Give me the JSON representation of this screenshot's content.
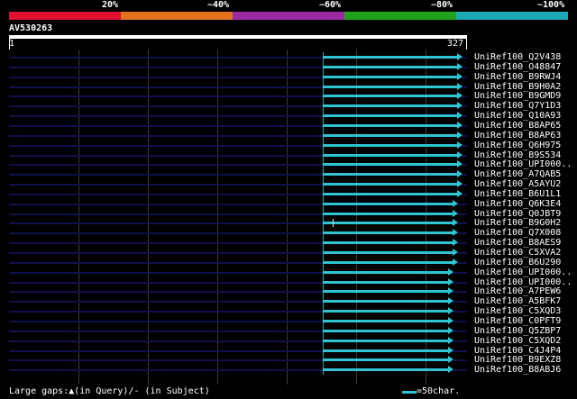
{
  "scale": {
    "labels": [
      "20%",
      "~40%",
      "~60%",
      "~80%",
      "~100%"
    ],
    "colors": [
      "#e01030",
      "#e0731c",
      "#9a2aa0",
      "#1fa21c",
      "#1aa8b4"
    ]
  },
  "query": {
    "title": "AV530263",
    "start": "1",
    "end": "327"
  },
  "hit_colors": {
    "bar": "#2fc4d2",
    "background_line": "#10104a",
    "gap_marker": "#d7dfe6"
  },
  "hits": [
    {
      "label": "UniRef100_Q2V438",
      "start_frac": 0.686,
      "end_frac": 0.99,
      "gap": null
    },
    {
      "label": "UniRef100_O48847",
      "start_frac": 0.686,
      "end_frac": 0.99,
      "gap": null
    },
    {
      "label": "UniRef100_B9RWJ4",
      "start_frac": 0.686,
      "end_frac": 0.99,
      "gap": null
    },
    {
      "label": "UniRef100_B9H0A2",
      "start_frac": 0.686,
      "end_frac": 0.99,
      "gap": null
    },
    {
      "label": "UniRef100_B9GMD9",
      "start_frac": 0.686,
      "end_frac": 0.99,
      "gap": null
    },
    {
      "label": "UniRef100_Q7Y1D3",
      "start_frac": 0.686,
      "end_frac": 0.99,
      "gap": null
    },
    {
      "label": "UniRef100_Q10A93",
      "start_frac": 0.686,
      "end_frac": 0.99,
      "gap": null
    },
    {
      "label": "UniRef100_B8AP65",
      "start_frac": 0.686,
      "end_frac": 0.99,
      "gap": null
    },
    {
      "label": "UniRef100_B8AP63",
      "start_frac": 0.686,
      "end_frac": 0.99,
      "gap": null
    },
    {
      "label": "UniRef100_Q6H975",
      "start_frac": 0.686,
      "end_frac": 0.99,
      "gap": null
    },
    {
      "label": "UniRef100_B9S534",
      "start_frac": 0.686,
      "end_frac": 0.99,
      "gap": null
    },
    {
      "label": "UniRef100_UPI000..",
      "start_frac": 0.686,
      "end_frac": 0.99,
      "gap": null
    },
    {
      "label": "UniRef100_A7QAB5",
      "start_frac": 0.686,
      "end_frac": 0.99,
      "gap": null
    },
    {
      "label": "UniRef100_A5AYU2",
      "start_frac": 0.686,
      "end_frac": 0.99,
      "gap": null
    },
    {
      "label": "UniRef100_B6U1L1",
      "start_frac": 0.686,
      "end_frac": 0.99,
      "gap": null
    },
    {
      "label": "UniRef100_Q6K3E4",
      "start_frac": 0.686,
      "end_frac": 0.98,
      "gap": null
    },
    {
      "label": "UniRef100_Q0JBT9",
      "start_frac": 0.686,
      "end_frac": 0.98,
      "gap": null
    },
    {
      "label": "UniRef100_B9G0H2",
      "start_frac": 0.686,
      "end_frac": 0.98,
      "gap": 0.707
    },
    {
      "label": "UniRef100_Q7X008",
      "start_frac": 0.686,
      "end_frac": 0.98,
      "gap": null
    },
    {
      "label": "UniRef100_B8AES9",
      "start_frac": 0.686,
      "end_frac": 0.98,
      "gap": null
    },
    {
      "label": "UniRef100_C5XVA2",
      "start_frac": 0.686,
      "end_frac": 0.98,
      "gap": null
    },
    {
      "label": "UniRef100_B6U290",
      "start_frac": 0.686,
      "end_frac": 0.98,
      "gap": null
    },
    {
      "label": "UniRef100_UPI000..",
      "start_frac": 0.686,
      "end_frac": 0.97,
      "gap": null
    },
    {
      "label": "UniRef100_UPI000..",
      "start_frac": 0.686,
      "end_frac": 0.97,
      "gap": null
    },
    {
      "label": "UniRef100_A7PEW6",
      "start_frac": 0.686,
      "end_frac": 0.97,
      "gap": null
    },
    {
      "label": "UniRef100_A5BFK7",
      "start_frac": 0.686,
      "end_frac": 0.97,
      "gap": null
    },
    {
      "label": "UniRef100_C5XQD3",
      "start_frac": 0.686,
      "end_frac": 0.97,
      "gap": null
    },
    {
      "label": "UniRef100_C0PFT9",
      "start_frac": 0.686,
      "end_frac": 0.97,
      "gap": null
    },
    {
      "label": "UniRef100_Q5ZBP7",
      "start_frac": 0.686,
      "end_frac": 0.97,
      "gap": null
    },
    {
      "label": "UniRef100_C5XQD2",
      "start_frac": 0.686,
      "end_frac": 0.97,
      "gap": null
    },
    {
      "label": "UniRef100_C4J4P4",
      "start_frac": 0.686,
      "end_frac": 0.97,
      "gap": null
    },
    {
      "label": "UniRef100_B9EXZ8",
      "start_frac": 0.686,
      "end_frac": 0.97,
      "gap": null
    },
    {
      "label": "UniRef100_B8ABJ6",
      "start_frac": 0.686,
      "end_frac": 0.97,
      "gap": null
    }
  ],
  "footer": {
    "gaps_legend": "Large gaps:▲(in Query)/- (in Subject)",
    "scale_legend": "=50char."
  }
}
